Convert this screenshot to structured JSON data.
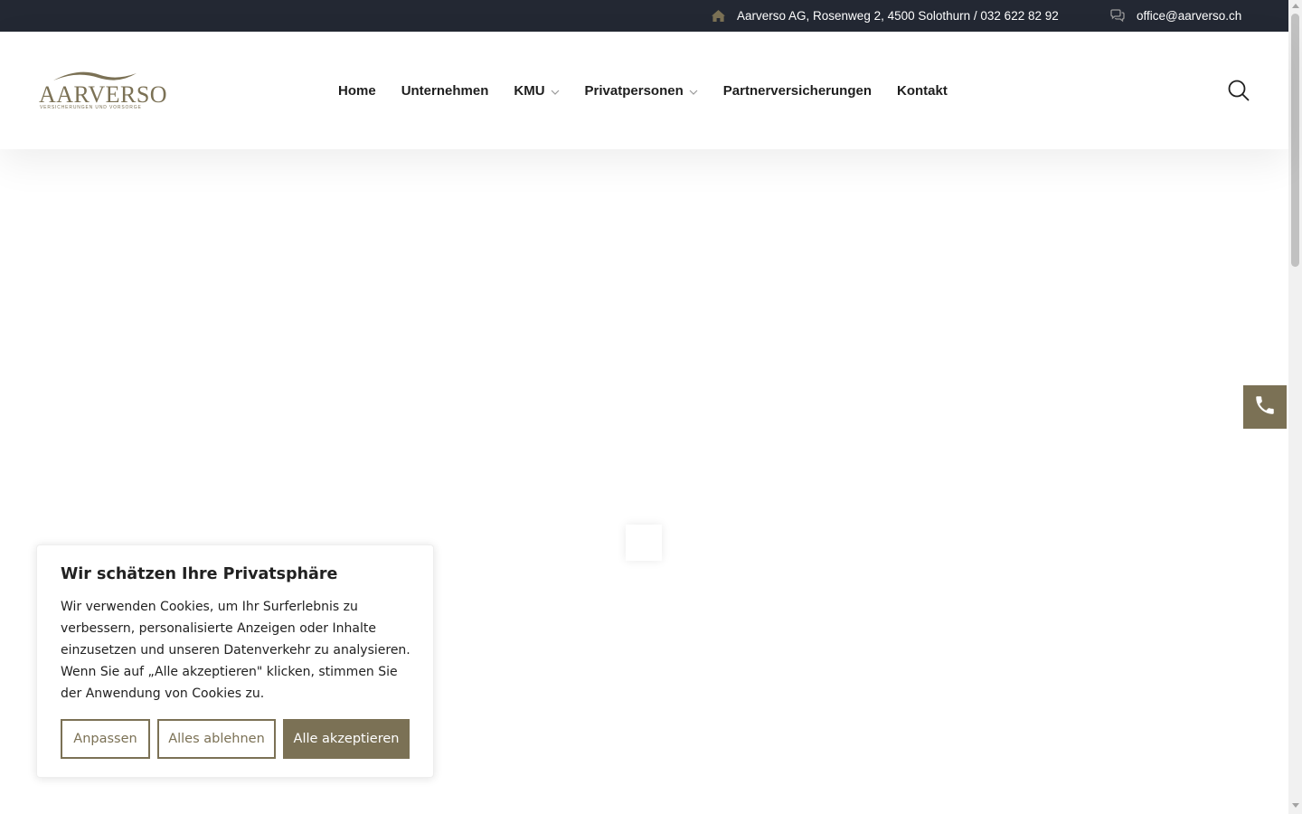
{
  "topbar": {
    "address": "Aarverso AG, Rosenweg 2, 4500 Solothurn / 032 622 82 92",
    "email": "office@aarverso.ch",
    "address_icon": "home-icon",
    "email_icon": "chat-bubbles-icon"
  },
  "header": {
    "logo": {
      "wordmark": "AARVERSO",
      "tagline": "VERSICHERUNGEN UND VORSORGE"
    },
    "nav": [
      {
        "label": "Home"
      },
      {
        "label": "Unternehmen"
      },
      {
        "label": "KMU",
        "has_dropdown": true
      },
      {
        "label": "Privatpersonen",
        "has_dropdown": true
      },
      {
        "label": "Partnerversicherungen"
      },
      {
        "label": "Kontakt"
      }
    ],
    "search_icon": "search-icon"
  },
  "floating": {
    "phone_icon": "phone-icon"
  },
  "cookie_banner": {
    "title": "Wir schätzen Ihre Privatsphäre",
    "text": "Wir verwenden Cookies, um Ihr Surferlebnis zu verbessern, personalisierte Anzeigen oder Inhalte einzusetzen und unseren Datenverkehr zu analysieren. Wenn Sie auf „Alle akzeptieren\" klicken, stimmen Sie der Anwendung von Cookies zu.",
    "buttons": {
      "customize": "Anpassen",
      "reject": "Alles ablehnen",
      "accept": "Alle akzeptieren"
    }
  },
  "colors": {
    "brand": "#7b7155",
    "topbar_bg": "#232833",
    "text": "#1e1e1e"
  }
}
